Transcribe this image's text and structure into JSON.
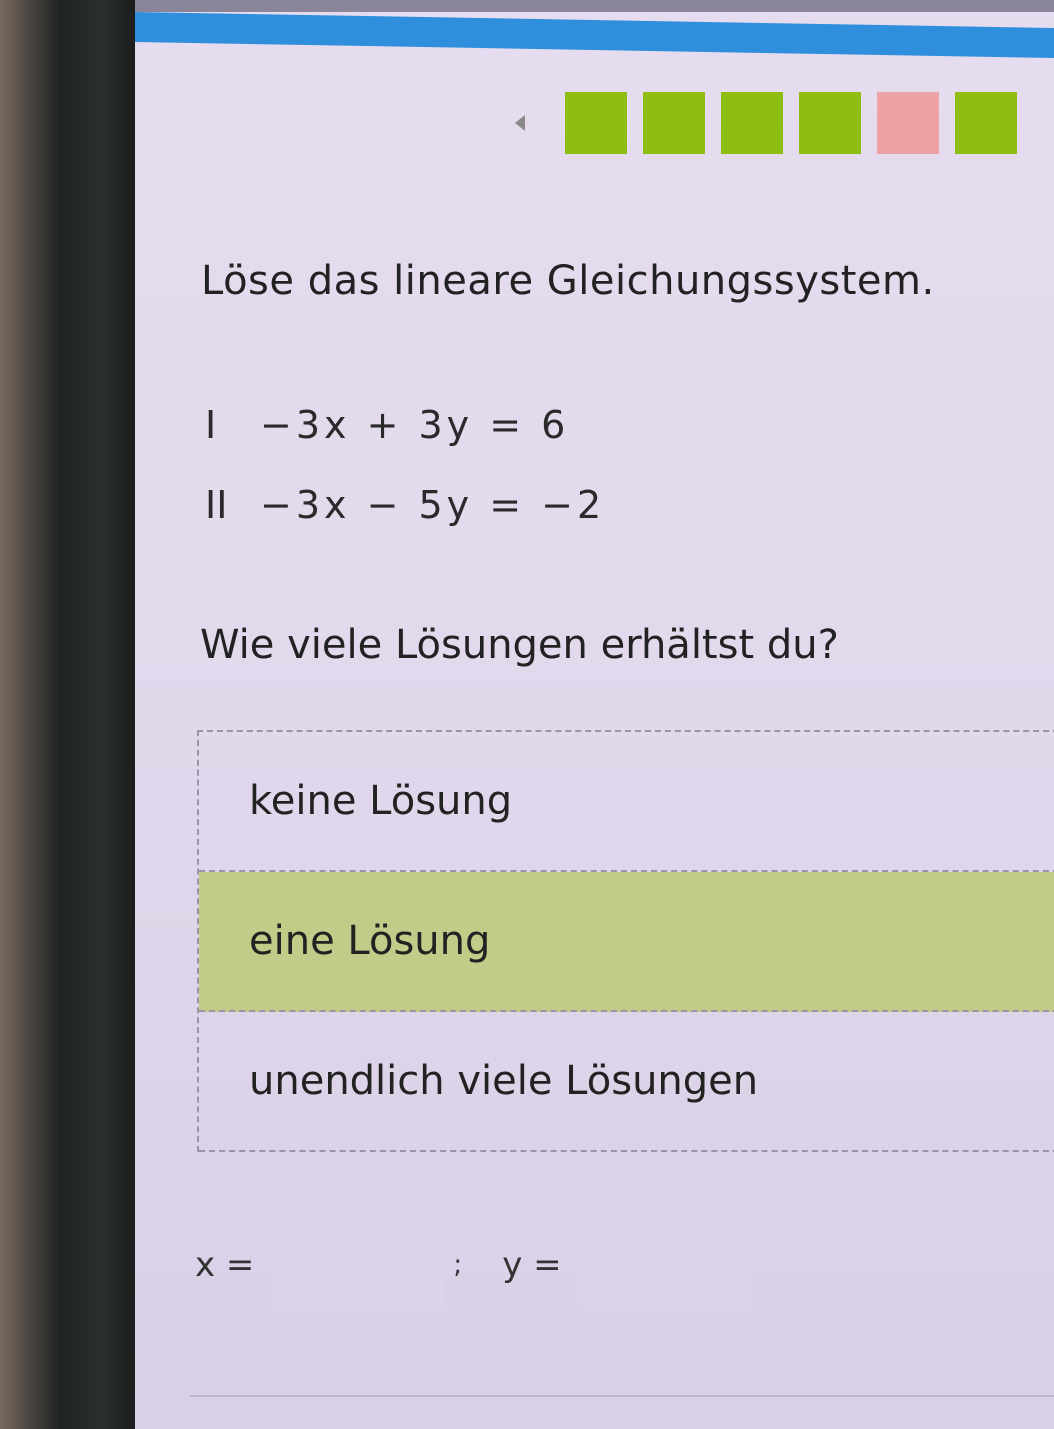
{
  "progress": {
    "segments": [
      {
        "status": "correct"
      },
      {
        "status": "correct"
      },
      {
        "status": "correct"
      },
      {
        "status": "correct"
      },
      {
        "status": "wrong"
      },
      {
        "status": "correct"
      }
    ],
    "colors": {
      "correct": "#8fbe12",
      "wrong": "#eda3a6",
      "topbar": "#2f8fdc"
    }
  },
  "task": {
    "title": "Löse das lineare Gleichungssystem.",
    "equations": [
      {
        "label": "I",
        "text": "−3x + 3y = 6"
      },
      {
        "label": "II",
        "text": "−3x − 5y = −2"
      }
    ],
    "question": "Wie viele Lösungen erhältst du?"
  },
  "options": [
    {
      "label": "keine Lösung",
      "selected": false
    },
    {
      "label": "eine Lösung",
      "selected": true
    },
    {
      "label": "unendlich viele Lösungen",
      "selected": false
    }
  ],
  "answer": {
    "x_label": "x =",
    "y_label": "y =",
    "separator": ";",
    "x_value": "",
    "y_value": ""
  },
  "icons": {
    "prev": "chevron-left-icon"
  }
}
